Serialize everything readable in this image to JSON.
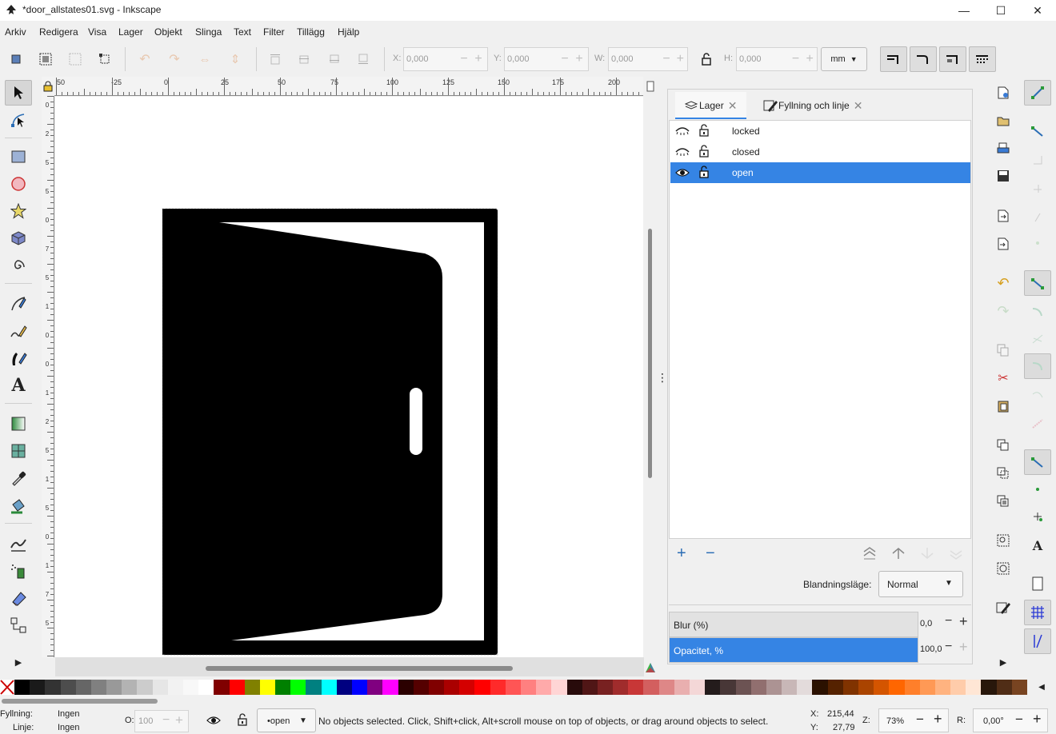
{
  "window": {
    "title": "*door_allstates01.svg - Inkscape",
    "controls": [
      "—",
      "☐",
      "✕"
    ]
  },
  "menu": [
    "Arkiv",
    "Redigera",
    "Visa",
    "Lager",
    "Objekt",
    "Slinga",
    "Text",
    "Filter",
    "Tillägg",
    "Hjälp"
  ],
  "coords": {
    "x_label": "X:",
    "x_value": "0,000",
    "y_label": "Y:",
    "y_value": "0,000",
    "w_label": "W:",
    "w_value": "0,000",
    "h_label": "H:",
    "h_value": "0,000",
    "unit": "mm"
  },
  "ruler": {
    "top": [
      "50",
      "-25",
      "0",
      "25",
      "50",
      "75",
      "100",
      "125",
      "150",
      "175",
      "200"
    ],
    "left": [
      "0",
      "2",
      "5",
      "5",
      "0",
      "7",
      "5",
      "1",
      "0",
      "0",
      "1",
      "2",
      "5",
      "1",
      "5",
      "0",
      "1",
      "7",
      "5"
    ]
  },
  "panel": {
    "tab_layers": "Lager",
    "tab_fill": "Fyllning och linje",
    "layers": [
      {
        "name": "locked",
        "selected": false,
        "visible": false
      },
      {
        "name": "closed",
        "selected": false,
        "visible": false
      },
      {
        "name": "open",
        "selected": true,
        "visible": true
      }
    ],
    "blend_label": "Blandningsläge:",
    "blend_value": "Normal",
    "blur_label": "Blur (%)",
    "blur_value": "0,0",
    "opacity_label": "Opacitet, %",
    "opacity_value": "100,0",
    "opacity_fraction": 1.0
  },
  "palette": [
    "#000000",
    "#1a1a1a",
    "#333333",
    "#4d4d4d",
    "#666666",
    "#808080",
    "#999999",
    "#b3b3b3",
    "#cccccc",
    "#e6e6e6",
    "#f2f2f2",
    "#f8f8f8",
    "#ffffff",
    "#800000",
    "#ff0000",
    "#808000",
    "#ffff00",
    "#008000",
    "#00ff00",
    "#008080",
    "#00ffff",
    "#000080",
    "#0000ff",
    "#800080",
    "#ff00ff",
    "#2b0000",
    "#550000",
    "#800000",
    "#aa0000",
    "#d40000",
    "#ff0000",
    "#ff2a2a",
    "#ff5555",
    "#ff8080",
    "#ffaaaa",
    "#ffd5d5",
    "#280b0b",
    "#501616",
    "#782121",
    "#a02c2c",
    "#c83737",
    "#d35f5f",
    "#de8787",
    "#e9afaf",
    "#f4d7d7",
    "#241c1c",
    "#483737",
    "#6c5353",
    "#916f6f",
    "#ac9393",
    "#c8b7b7",
    "#e3dbdb",
    "#2b1100",
    "#552200",
    "#803300",
    "#aa4400",
    "#d45500",
    "#ff6600",
    "#ff7f2a",
    "#ff9955",
    "#ffb380",
    "#ffccaa",
    "#ffe6d5",
    "#28170b",
    "#502d16",
    "#784421"
  ],
  "status": {
    "fill_label": "Fyllning:",
    "fill_value": "Ingen",
    "stroke_label": "Linje:",
    "stroke_value": "Ingen",
    "opacity_label": "O:",
    "opacity_value": "100",
    "layer_name": "•open",
    "message": "No objects selected. Click, Shift+click, Alt+scroll mouse on top of objects, or drag around objects to select.",
    "x_label": "X:",
    "x_value": "215,44",
    "y_label": "Y:",
    "y_value": "27,79",
    "zoom_label": "Z:",
    "zoom_value": "73%",
    "rotate_label": "R:",
    "rotate_value": "0,00°"
  },
  "colors": {
    "accent": "#3584e4",
    "canvas": "#ffffff",
    "door": "#000000"
  }
}
